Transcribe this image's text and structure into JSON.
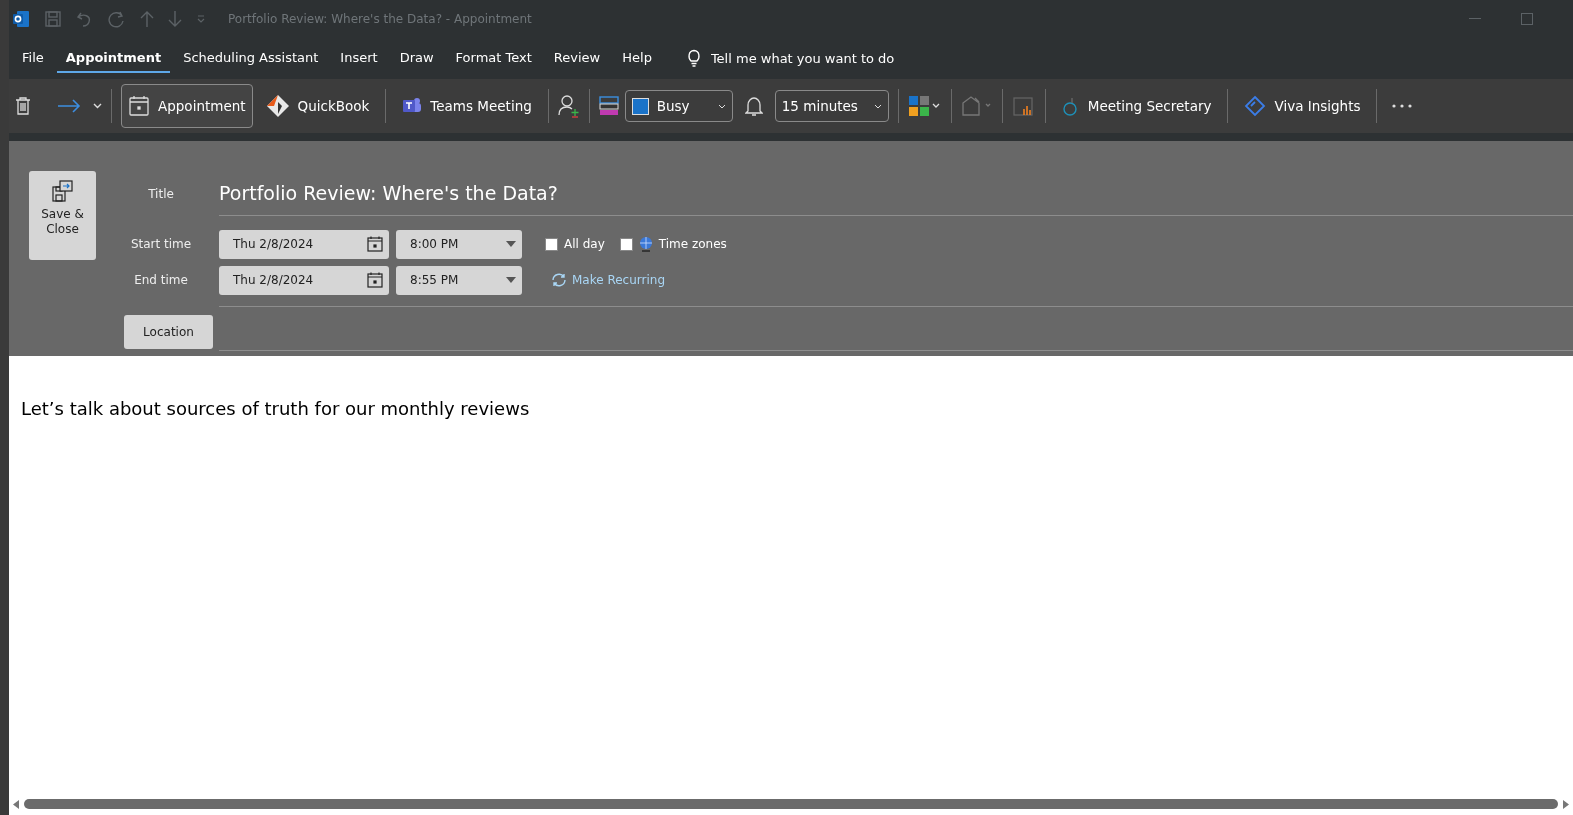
{
  "window": {
    "title": "Portfolio Review:  Where's the Data?  -  Appointment"
  },
  "menu_tabs": [
    {
      "label": "File",
      "selected": false
    },
    {
      "label": "Appointment",
      "selected": true
    },
    {
      "label": "Scheduling Assistant",
      "selected": false
    },
    {
      "label": "Insert",
      "selected": false
    },
    {
      "label": "Draw",
      "selected": false
    },
    {
      "label": "Format Text",
      "selected": false
    },
    {
      "label": "Review",
      "selected": false
    },
    {
      "label": "Help",
      "selected": false
    }
  ],
  "tell_me": {
    "placeholder": "Tell me what you want to do"
  },
  "toolbar": {
    "appointment": {
      "label": "Appointment",
      "selected": true
    },
    "quickbook": "QuickBook",
    "teams_meeting": "Teams Meeting",
    "show_as": {
      "value": "Busy"
    },
    "reminder": {
      "value": "15 minutes"
    },
    "meeting_secretary": "Meeting Secretary",
    "viva_insights": "Viva Insights"
  },
  "form": {
    "save_close": "Save & Close",
    "title_label": "Title",
    "title": "Portfolio Review:  Where's the Data?",
    "start_label": "Start time",
    "start_date": "Thu 2/8/2024",
    "start_time": "8:00 PM",
    "all_day": {
      "label": "All day",
      "checked": false
    },
    "time_zones": {
      "label": "Time zones",
      "checked": false
    },
    "end_label": "End time",
    "end_date": "Thu 2/8/2024",
    "end_time": "8:55 PM",
    "make_recurring": "Make Recurring",
    "location": "Location"
  },
  "body": "Let’s talk about sources of truth for our monthly reviews"
}
